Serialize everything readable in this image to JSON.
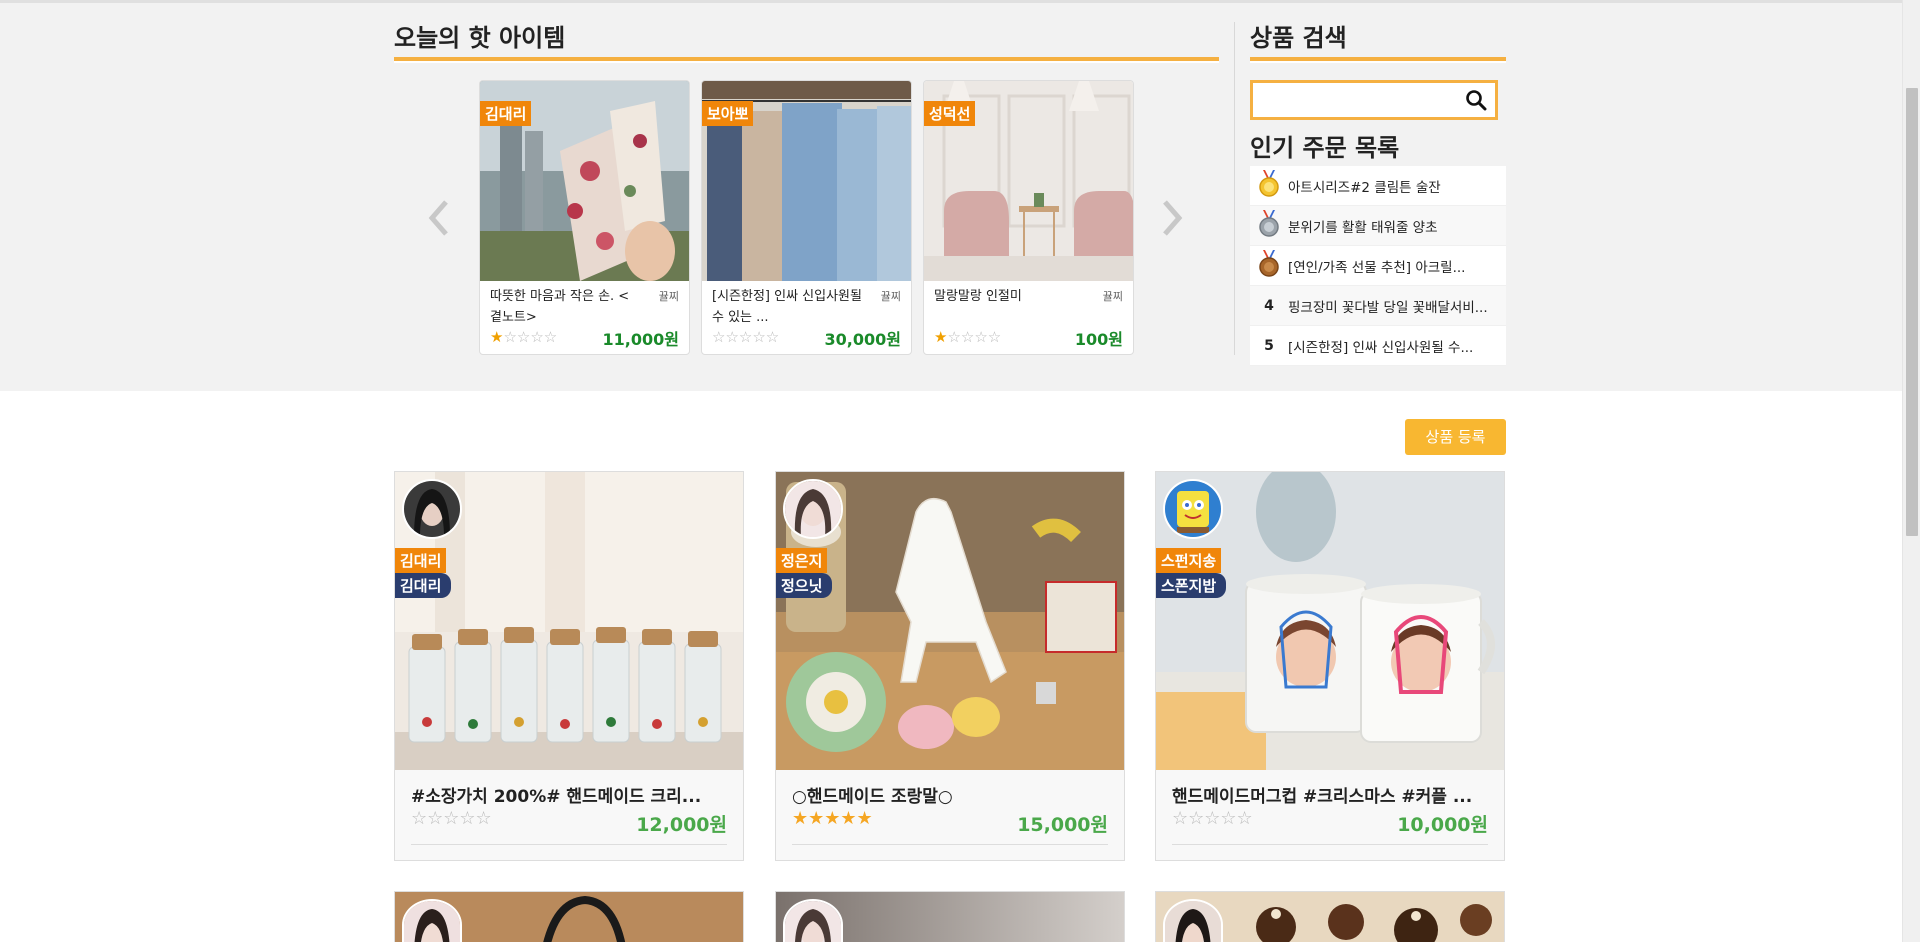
{
  "hot": {
    "title": "오늘의 핫 아이템",
    "items": [
      {
        "seller": "김대리",
        "name": "따뜻한 마음과 작은 손. <곁노트>",
        "tag": "뀰찌",
        "rating": 1,
        "price": "11,000원"
      },
      {
        "seller": "보아뽀",
        "name": "[시즌한정] 인싸 신입사원될 수 있는 ...",
        "tag": "뀰찌",
        "rating": 0,
        "price": "30,000원"
      },
      {
        "seller": "성덕선",
        "name": "말랑말랑 인절미",
        "tag": "뀰찌",
        "rating": 1,
        "price": "100원"
      }
    ]
  },
  "search": {
    "title": "상품 검색",
    "value": "",
    "placeholder": ""
  },
  "popular": {
    "title": "인기 주문 목록",
    "items": [
      {
        "rank": "1",
        "medal": "gold",
        "text": "아트시리즈#2 클림튼 술잔"
      },
      {
        "rank": "2",
        "medal": "silver",
        "text": "분위기를 활활 태워줄 양초"
      },
      {
        "rank": "3",
        "medal": "bronze",
        "text": "[연인/가족 선물 추천] 아크릴..."
      },
      {
        "rank": "4",
        "medal": "",
        "text": "핑크장미 꽃다발 당일 꽃배달서비..."
      },
      {
        "rank": "5",
        "medal": "",
        "text": "[시즌한정] 인싸 신입사원될 수..."
      }
    ]
  },
  "register": {
    "label": "상품 등록"
  },
  "products": [
    {
      "nick1": "김대리",
      "nick2": "김대리",
      "title": "#소장가치 200%# 핸드메이드 크리...",
      "rating": 0,
      "price": "12,000원"
    },
    {
      "nick1": "정은지",
      "nick2": "정으닛",
      "title": "○핸드메이드 조랑말○",
      "rating": 5,
      "price": "15,000원"
    },
    {
      "nick1": "스펀지송",
      "nick2": "스폰지밥",
      "title": "핸드메이드머그컵 #크리스마스 #커플 ...",
      "rating": 0,
      "price": "10,000원"
    }
  ],
  "colors": {
    "accent": "#f5b041",
    "seller_badge": "#f0860a",
    "nick_badge": "#2a3d6e",
    "price_green": "#1a8a2a",
    "button": "#f8b731"
  }
}
